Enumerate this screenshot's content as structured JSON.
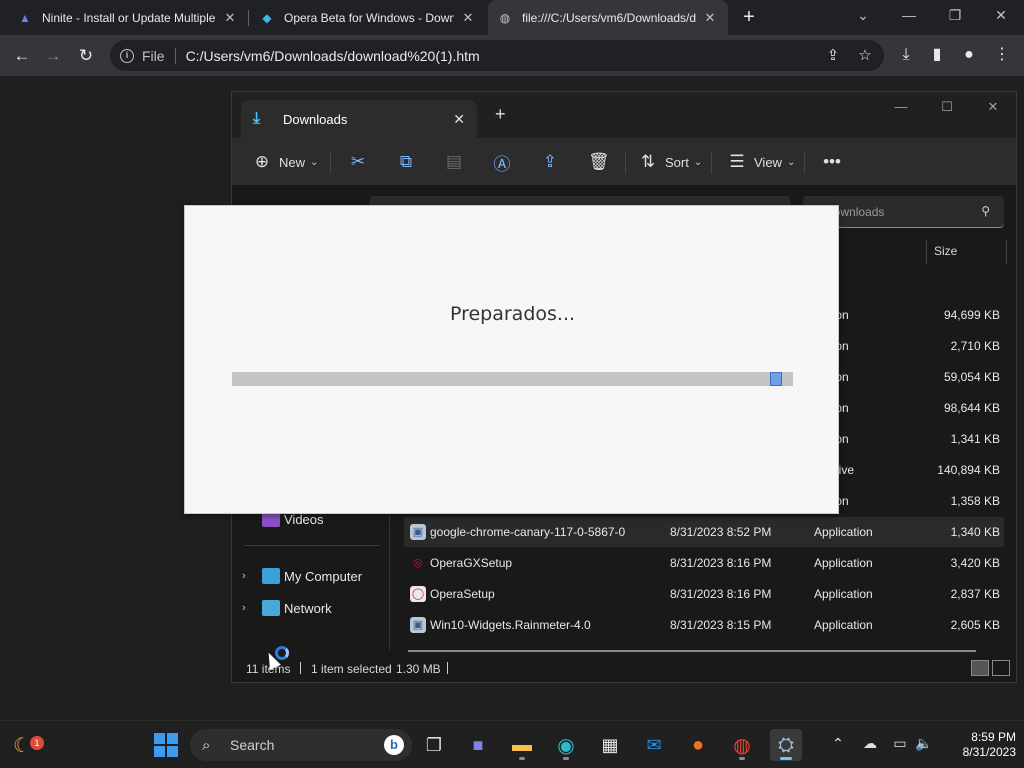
{
  "browser": {
    "tabs": [
      {
        "label": "Ninite - Install or Update Multiple",
        "icon": "ninite-icon"
      },
      {
        "label": "Opera Beta for Windows - Download",
        "icon": "opera-icon"
      },
      {
        "label": "file:///C:/Users/vm6/Downloads/d",
        "icon": "globe-icon"
      }
    ],
    "scheme": "File",
    "url": "C:/Users/vm6/Downloads/download%20(1).htm"
  },
  "explorer": {
    "tab_title": "Downloads",
    "commands": {
      "new": "New",
      "sort": "Sort",
      "view": "View"
    },
    "search_placeholder": "h Downloads",
    "columns": {
      "size": "Size"
    },
    "nav": [
      {
        "label": "My Computer",
        "icon": "computer-icon"
      },
      {
        "label": "Network",
        "icon": "network-icon"
      }
    ],
    "partial_nav_label": "Videos",
    "rows": [
      {
        "name": "",
        "date": "",
        "type": "ication",
        "size": "94,699 KB"
      },
      {
        "name": "",
        "date": "",
        "type": "ication",
        "size": "2,710 KB"
      },
      {
        "name": "",
        "date": "",
        "type": "ication",
        "size": "59,054 KB"
      },
      {
        "name": "",
        "date": "",
        "type": "ication",
        "size": "98,644 KB"
      },
      {
        "name": "",
        "date": "",
        "type": "ication",
        "size": "1,341 KB"
      },
      {
        "name": "",
        "date": "",
        "type": "Archive",
        "size": "140,894 KB"
      },
      {
        "name": "",
        "date": "",
        "type": "ication",
        "size": "1,358 KB"
      },
      {
        "name": "google-chrome-canary-117-0-5867-0",
        "date": "8/31/2023 8:52 PM",
        "type": "Application",
        "size": "1,340 KB"
      },
      {
        "name": "OperaGXSetup",
        "date": "8/31/2023 8:16 PM",
        "type": "Application",
        "size": "3,420 KB"
      },
      {
        "name": "OperaSetup",
        "date": "8/31/2023 8:16 PM",
        "type": "Application",
        "size": "2,837 KB"
      },
      {
        "name": "Win10-Widgets.Rainmeter-4.0",
        "date": "8/31/2023 8:15 PM",
        "type": "Application",
        "size": "2,605 KB"
      }
    ],
    "status": {
      "items": "11 items",
      "selected": "1 item selected",
      "size": "1.30 MB"
    }
  },
  "dialog": {
    "message": "Preparados...",
    "progress": 0.98
  },
  "taskbar": {
    "search_label": "Search",
    "notification_count": "1",
    "time": "8:59 PM",
    "date": "8/31/2023"
  },
  "colors": {
    "accent": "#60cdff",
    "progress_fill": "#6fa0e6",
    "explorer_bg": "#191919"
  }
}
